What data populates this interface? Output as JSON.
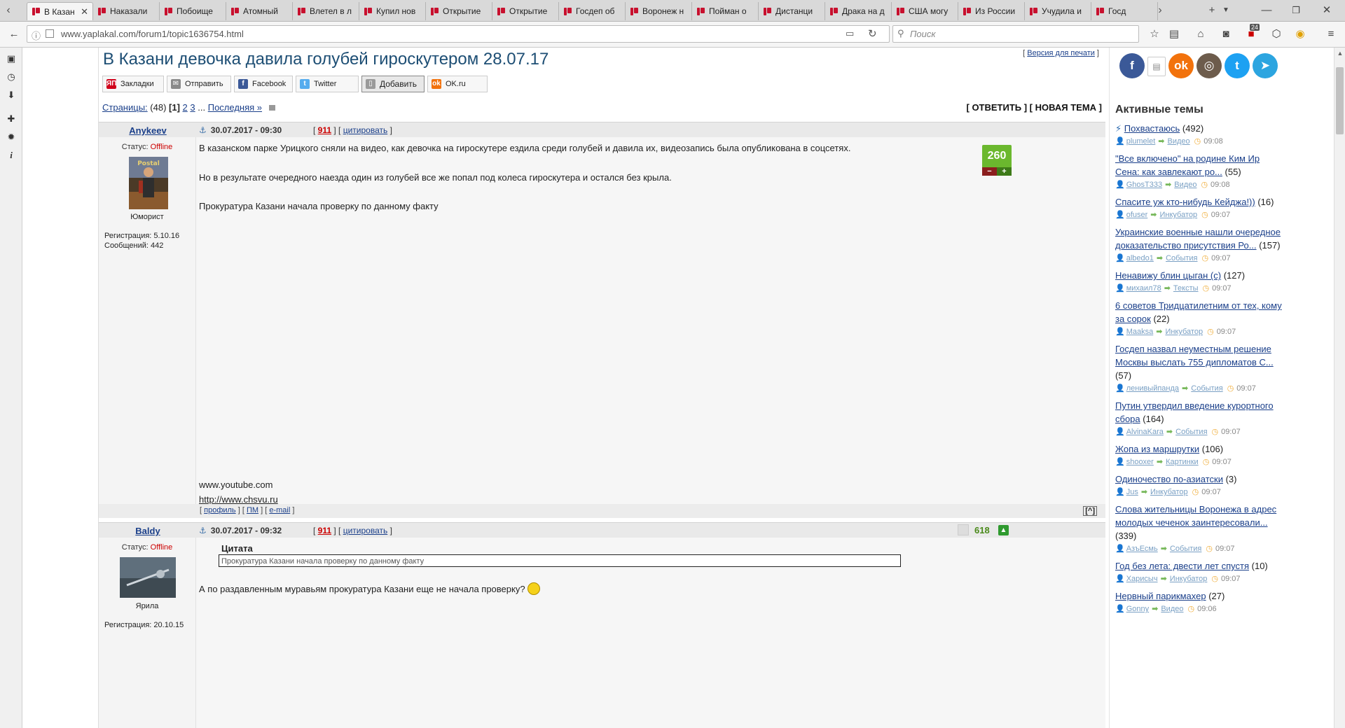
{
  "browser": {
    "tabs": [
      {
        "label": "В Казан"
      },
      {
        "label": "Наказали"
      },
      {
        "label": "Побоище"
      },
      {
        "label": "Атомный"
      },
      {
        "label": "Влетел в л"
      },
      {
        "label": "Купил нов"
      },
      {
        "label": "Открытие"
      },
      {
        "label": "Открытие"
      },
      {
        "label": "Госдеп об"
      },
      {
        "label": "Воронеж н"
      },
      {
        "label": "Пойман о"
      },
      {
        "label": "Дистанци"
      },
      {
        "label": "Драка на д"
      },
      {
        "label": "США могу"
      },
      {
        "label": "Из России"
      },
      {
        "label": "Учудила и"
      },
      {
        "label": "Госд"
      }
    ],
    "url": "www.yaplakal.com/forum1/topic1636754.html",
    "search_placeholder": "Поиск",
    "notification_count": "24"
  },
  "topic": {
    "title": "В Казани девочка давила голубей гироскутером 28.07.17",
    "print_link": "Версия для печати"
  },
  "share": [
    {
      "label": "Закладки",
      "icon": "yaplakal-icon",
      "color": "#d0021b"
    },
    {
      "label": "Отправить",
      "icon": "mail-icon",
      "color": "#8a8a8a"
    },
    {
      "label": "Facebook",
      "icon": "facebook-icon",
      "color": "#3b5998"
    },
    {
      "label": "Twitter",
      "icon": "twitter-icon",
      "color": "#55acee"
    },
    {
      "label": "Добавить",
      "icon": "add-doc-icon",
      "color": "#9a9a9a"
    },
    {
      "label": "OK.ru",
      "icon": "odnoklassniki-icon",
      "color": "#f2720c"
    }
  ],
  "pager": {
    "label": "Страницы:",
    "count": "(48)",
    "current": "[1]",
    "p2": "2",
    "p3": "3",
    "ellipsis": "...",
    "last": "Последняя »"
  },
  "actions": {
    "reply": "ОТВЕТИТЬ",
    "new_topic": "НОВАЯ ТЕМА"
  },
  "posts": [
    {
      "author": "Anykeev",
      "date": "30.07.2017 - 09:30",
      "num": "911",
      "quote_link": "цитировать",
      "status_label": "Статус:",
      "status": "Offline",
      "rank": "Юморист",
      "reg": "Регистрация: 5.10.16",
      "msgs": "Сообщений: 442",
      "p1": "В казанском парке Урицкого сняли на видео, как девочка на гироскутере ездила среди голубей и давила их, видеозапись была опубликована в соцсетях.",
      "p2": "Но в результате очередного наезда один из голубей все же попал под колеса гироскутера и остался без крыла.",
      "p3": "Прокуратура Казани начала проверку по данному факту",
      "src1": "www.youtube.com",
      "src2": "http://www.chsvu.ru",
      "score": "260",
      "minus": "−",
      "plus": "+",
      "footer": {
        "profile": "профиль",
        "pm": "ПМ",
        "email": "e-mail",
        "top": "[^]"
      }
    },
    {
      "author": "Baldy",
      "date": "30.07.2017 - 09:32",
      "num": "911",
      "quote_link": "цитировать",
      "status_label": "Статус:",
      "status": "Offline",
      "rank": "Ярила",
      "reg": "Регистрация: 20.10.15",
      "quote_title": "Цитата",
      "quote_text": "Прокуратура Казани начала проверку по данному факту",
      "text": "А по раздавленным муравьям прокуратура Казани еще не начала проверку?",
      "score": "618"
    }
  ],
  "sidebar": {
    "title": "Активные темы",
    "topics": [
      {
        "title": "Похвастаюсь",
        "count": "(492)",
        "user": "plumelet",
        "cat": "Видео",
        "time": "09:08",
        "hot": true
      },
      {
        "title": "\"Все включено\" на родине Ким Ир Сена: как завлекают ро...",
        "count": "(55)",
        "user": "GhosT333",
        "cat": "Видео",
        "time": "09:08"
      },
      {
        "title": "Спасите уж кто-нибудь Кейджа!))",
        "count": "(16)",
        "user": "ofuser",
        "cat": "Инкубатор",
        "time": "09:07"
      },
      {
        "title": "Украинские военные нашли очередное доказательство присутствия Ро...",
        "count": "(157)",
        "user": "albedo1",
        "cat": "События",
        "time": "09:07"
      },
      {
        "title": "Ненавижу блин цыган (с)",
        "count": "(127)",
        "user": "михаил78",
        "cat": "Тексты",
        "time": "09:07"
      },
      {
        "title": "6 советов Тридцатилетним от тех, кому за сорок",
        "count": "(22)",
        "user": "Maaksa",
        "cat": "Инкубатор",
        "time": "09:07"
      },
      {
        "title": "Госдеп назвал неуместным решение Москвы выслать 755 дипломатов С...",
        "count": "(57)",
        "user": "ленивыйпанда",
        "cat": "События",
        "time": "09:07"
      },
      {
        "title": "Путин утвердил введение курортного сбора",
        "count": "(164)",
        "user": "AlvinaKara",
        "cat": "События",
        "time": "09:07"
      },
      {
        "title": "Жопа из маршрутки",
        "count": "(106)",
        "user": "shooxer",
        "cat": "Картинки",
        "time": "09:07"
      },
      {
        "title": "Одиночество по-азиатски",
        "count": "(3)",
        "user": "Jus",
        "cat": "Инкубатор",
        "time": "09:07"
      },
      {
        "title": "Слова жительницы Воронежа в адрес молодых чеченок заинтересовали...",
        "count": "(339)",
        "user": "АзъЕсмь",
        "cat": "События",
        "time": "09:07"
      },
      {
        "title": "Год без лета: двести лет спустя",
        "count": "(10)",
        "user": "Харисыч",
        "cat": "Инкубатор",
        "time": "09:07"
      },
      {
        "title": "Нервный парикмахер",
        "count": "(27)",
        "user": "Gonny",
        "cat": "Видео",
        "time": "09:06"
      }
    ]
  },
  "colors": {
    "title": "#1d4e74",
    "link": "#1a3f8a",
    "score_green": "#6bb82e",
    "offline_red": "#cc0000"
  }
}
